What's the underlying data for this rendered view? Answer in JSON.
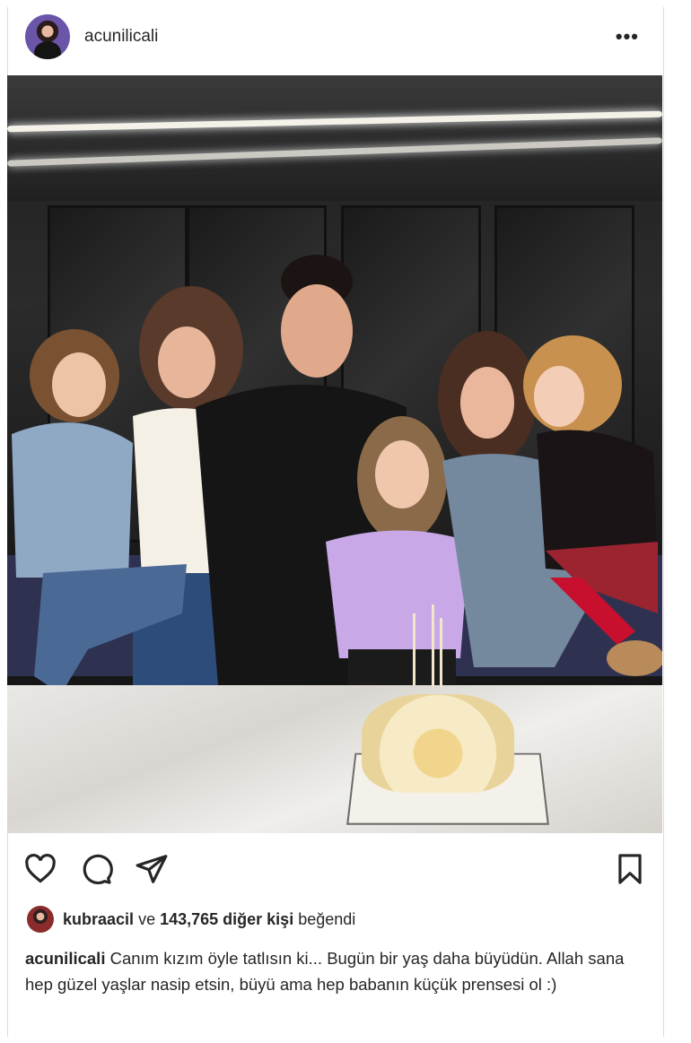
{
  "post": {
    "username": "acunilicali",
    "more_glyph": "•••",
    "likes": {
      "first_liker": "kubraacil",
      "connector": "ve",
      "count": "143,765 diğer kişi",
      "suffix": "beğendi"
    },
    "caption": {
      "username": "acunilicali",
      "text": "Canım kızım öyle tatlısın ki... Bugün bir yaş daha büyüdün. Allah sana hep güzel yaşlar nasip etsin, büyü ama hep babanın küçük prensesi ol :)"
    },
    "icons": {
      "like": "heart-icon",
      "comment": "comment-icon",
      "share": "send-icon",
      "save": "bookmark-icon"
    }
  }
}
